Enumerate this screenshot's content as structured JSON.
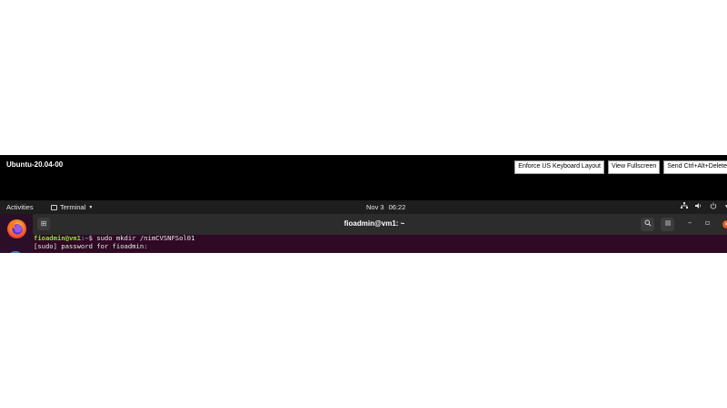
{
  "vm": {
    "title": "Ubuntu-20.04-00",
    "buttons": {
      "enforce_keyboard": "Enforce US Keyboard Layout",
      "view_fullscreen": "View Fullscreen",
      "send_cad": "Send Ctrl+Alt+Delete"
    }
  },
  "topbar": {
    "activities": "Activities",
    "app_name": "Terminal",
    "date": "Nov 3",
    "time": "06:22",
    "tray_icons": [
      "network-icon",
      "sound-icon",
      "power-icon"
    ]
  },
  "terminal": {
    "title": "fioadmin@vm1: ~",
    "lines": [
      {
        "prompt": "fioadmin@vm1",
        "path": ":~",
        "rest": "$ sudo mkdir /nimCVSNFSol01"
      },
      {
        "text": "[sudo] password for fioadmin:"
      }
    ]
  },
  "colors": {
    "accent_close": "#e95420",
    "terminal_bg": "#300a24",
    "prompt_green": "#8ae234",
    "path_blue": "#729fcf"
  }
}
